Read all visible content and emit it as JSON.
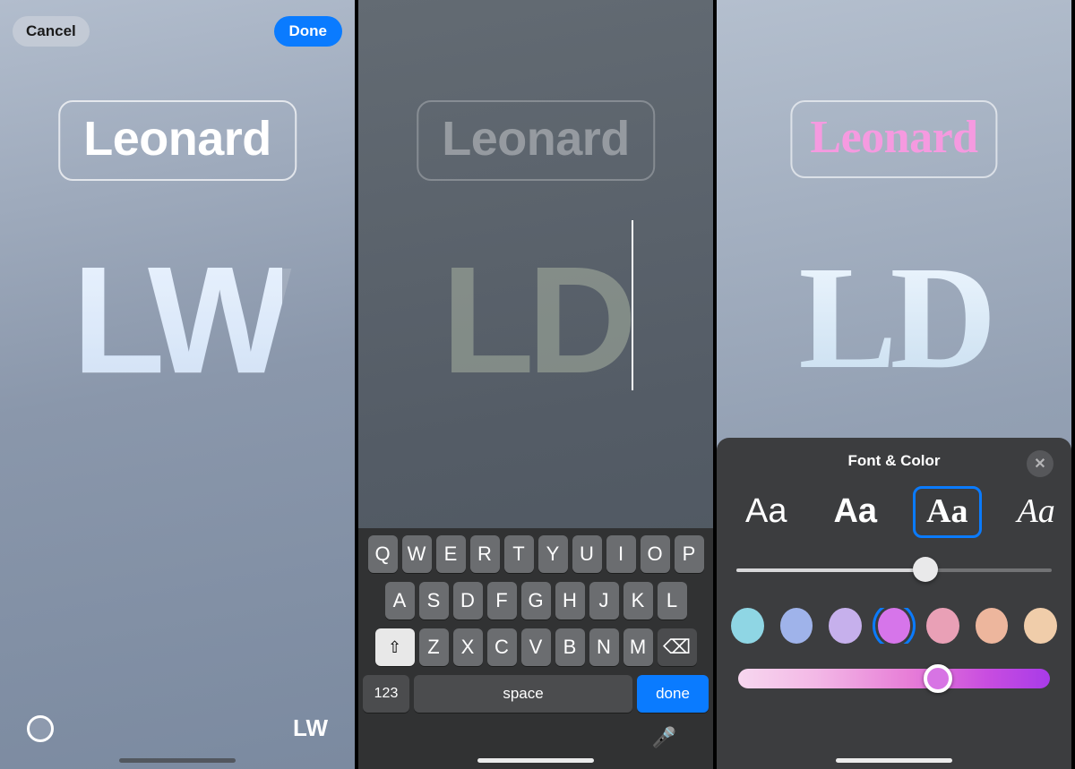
{
  "panel1": {
    "cancel_label": "Cancel",
    "done_label": "Done",
    "name": "Leonard",
    "monogram": "LW",
    "monogram_small": "LW"
  },
  "panel2": {
    "name": "Leonard",
    "monogram": "LD",
    "keyboard": {
      "row1": [
        "Q",
        "W",
        "E",
        "R",
        "T",
        "Y",
        "U",
        "I",
        "O",
        "P"
      ],
      "row2": [
        "A",
        "S",
        "D",
        "F",
        "G",
        "H",
        "J",
        "K",
        "L"
      ],
      "row3": [
        "Z",
        "X",
        "C",
        "V",
        "B",
        "N",
        "M"
      ],
      "shift_glyph": "⇧",
      "backspace_glyph": "⌫",
      "numbers_label": "123",
      "space_label": "space",
      "done_label": "done",
      "mic_glyph": "🎤"
    }
  },
  "panel3": {
    "name": "Leonard",
    "monogram": "LD",
    "sheet_title": "Font & Color",
    "close_glyph": "✕",
    "font_options": [
      "Aa",
      "Aa",
      "Aa",
      "Aa"
    ],
    "font_selected_index": 2,
    "size_slider_value_pct": 60,
    "color_swatches": [
      "#8fd6e4",
      "#9fb3ea",
      "#c6b0ec",
      "#d675ea",
      "#e9a0b6",
      "#edb69d",
      "#f0cdaa"
    ],
    "color_selected_index": 3,
    "hue_value_pct": 64,
    "hue_thumb_color": "#d774e4"
  }
}
